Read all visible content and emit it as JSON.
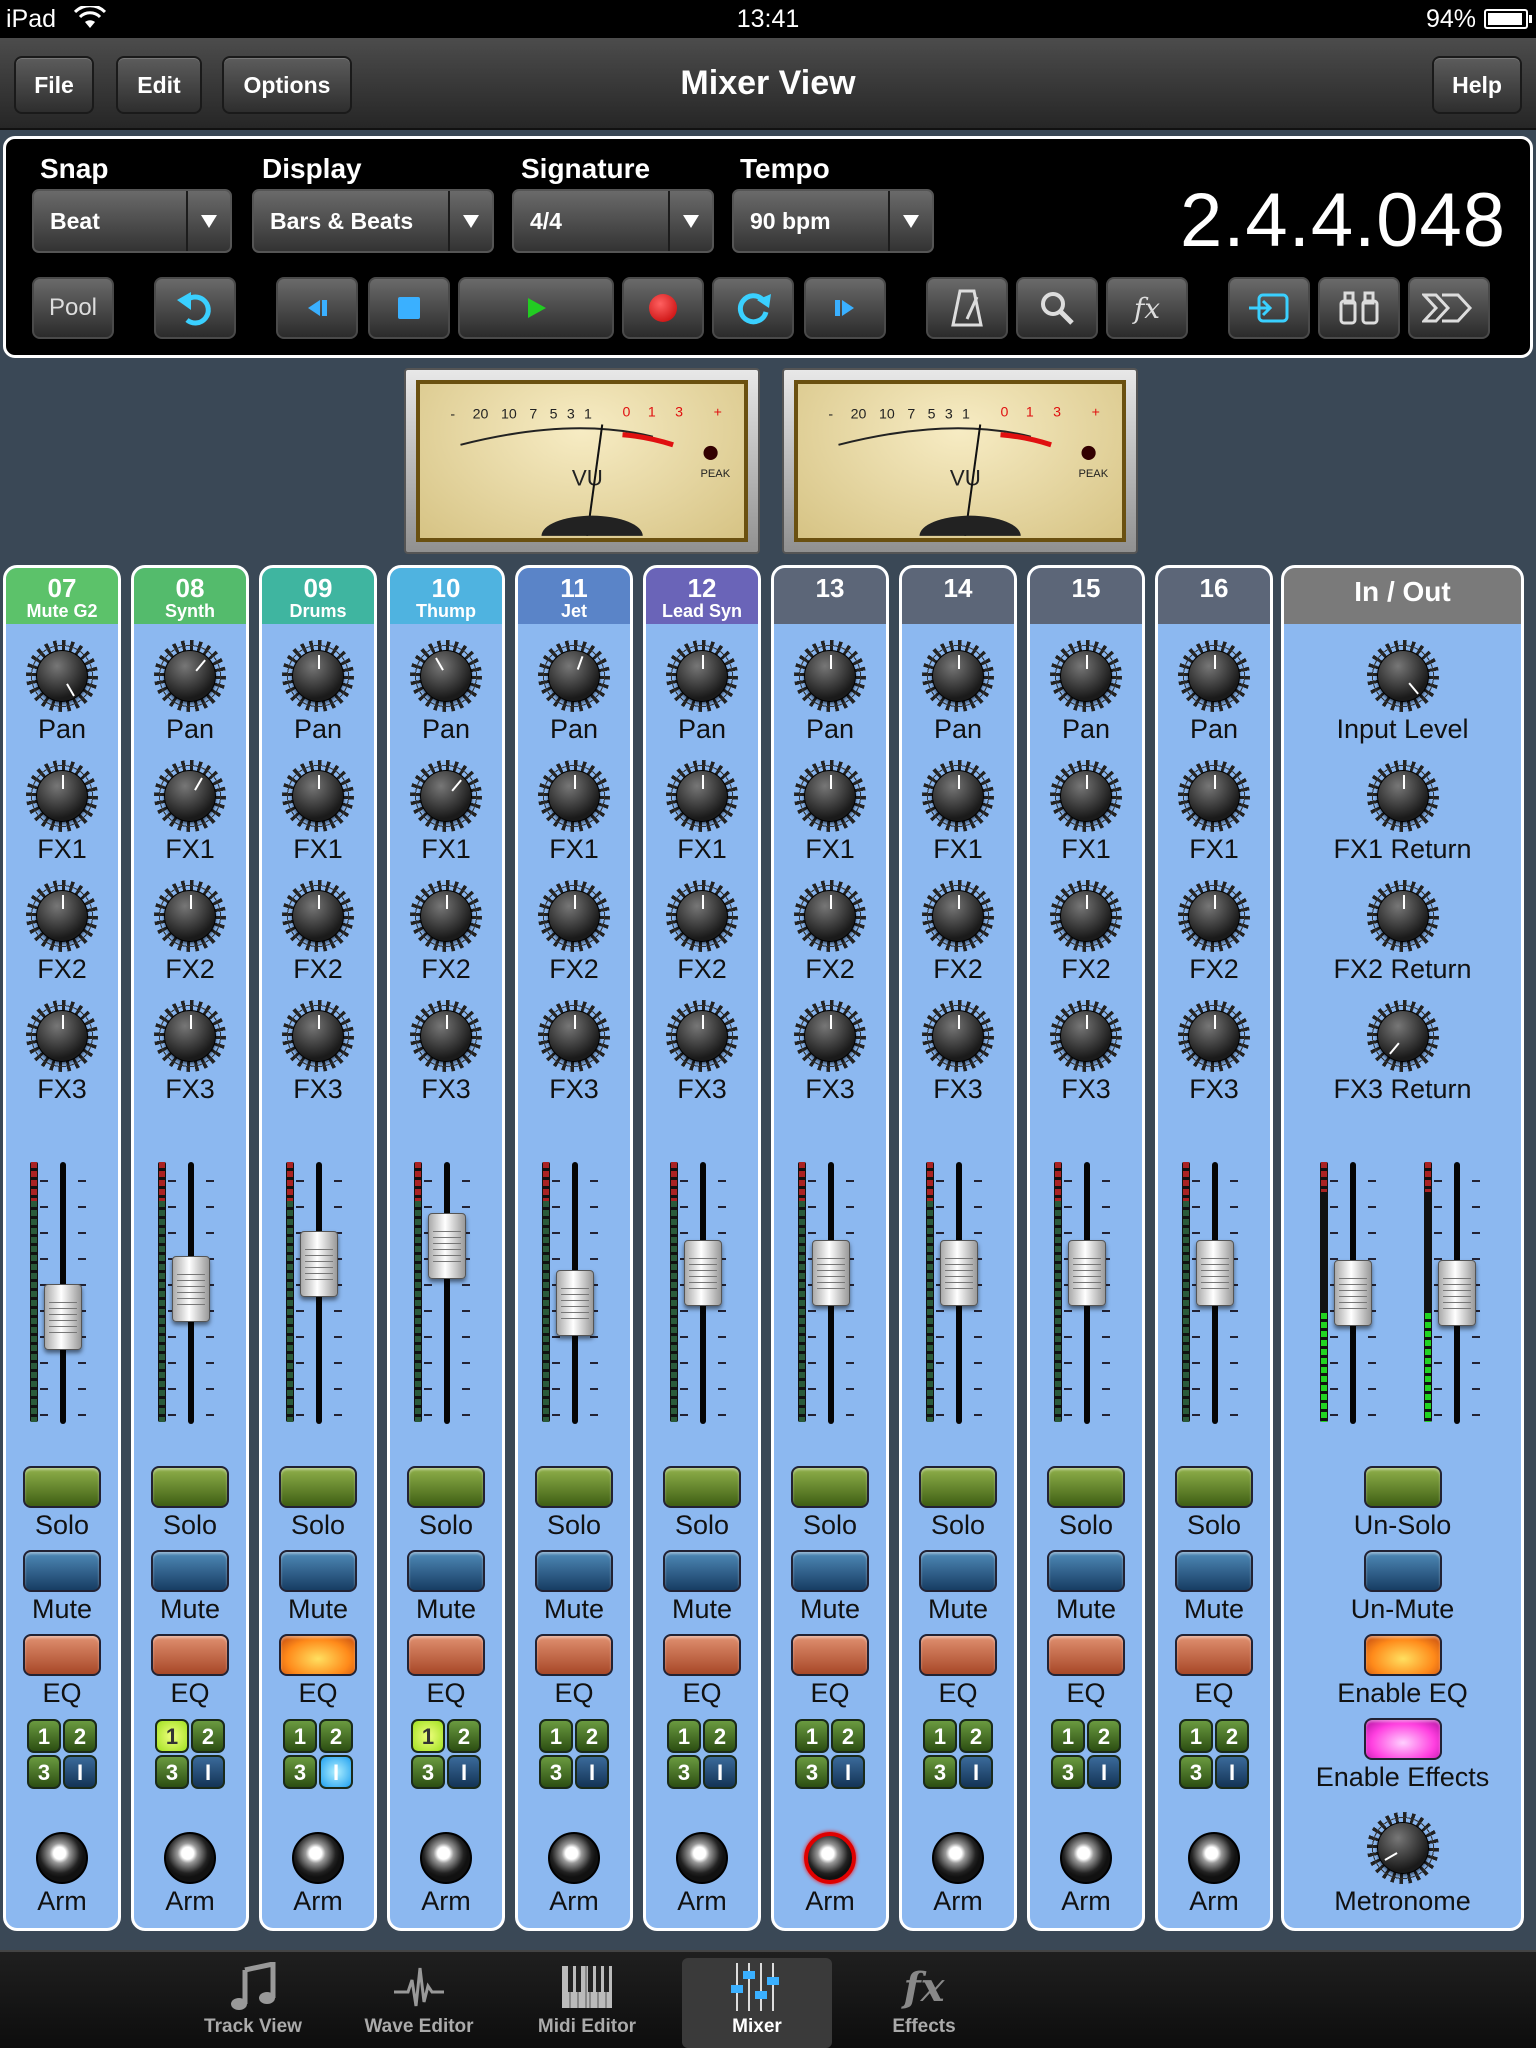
{
  "status": {
    "carrier": "iPad",
    "time": "13:41",
    "battery": "94%"
  },
  "nav": {
    "file": "File",
    "edit": "Edit",
    "options": "Options",
    "title": "Mixer View",
    "help": "Help"
  },
  "transport": {
    "snap_label": "Snap",
    "snap_value": "Beat",
    "display_label": "Display",
    "display_value": "Bars & Beats",
    "signature_label": "Signature",
    "signature_value": "4/4",
    "tempo_label": "Tempo",
    "tempo_value": "90 bpm",
    "position": "2.4.4.048",
    "pool": "Pool",
    "fx": "fx"
  },
  "vu": {
    "scale": [
      "-",
      "20",
      "10",
      "7",
      "5",
      "3",
      "1",
      "0",
      "1",
      "3",
      "+"
    ],
    "label": "VU",
    "peak": "PEAK"
  },
  "channels": [
    {
      "num": "07",
      "name": "Mute G2",
      "color": "#5cc26a",
      "fader": 0.38,
      "eq_on": false,
      "b1": false,
      "b4": false,
      "rec": false
    },
    {
      "num": "08",
      "name": "Synth",
      "color": "#54bb6c",
      "fader": 0.52,
      "eq_on": false,
      "b1": true,
      "b4": false,
      "rec": false
    },
    {
      "num": "09",
      "name": "Drums",
      "color": "#3fb5a0",
      "fader": 0.65,
      "eq_on": true,
      "b1": false,
      "b4": true,
      "rec": false
    },
    {
      "num": "10",
      "name": "Thump",
      "color": "#4fb3e0",
      "fader": 0.74,
      "eq_on": false,
      "b1": true,
      "b4": false,
      "rec": false
    },
    {
      "num": "11",
      "name": "Jet",
      "color": "#5a84c8",
      "fader": 0.45,
      "eq_on": false,
      "b1": false,
      "b4": false,
      "rec": false
    },
    {
      "num": "12",
      "name": "Lead Syn",
      "color": "#6a64b8",
      "fader": 0.6,
      "eq_on": false,
      "b1": false,
      "b4": false,
      "rec": false
    },
    {
      "num": "13",
      "name": "",
      "color": "#5c6678",
      "fader": 0.6,
      "eq_on": false,
      "b1": false,
      "b4": false,
      "rec": true
    },
    {
      "num": "14",
      "name": "",
      "color": "#5c6678",
      "fader": 0.6,
      "eq_on": false,
      "b1": false,
      "b4": false,
      "rec": false
    },
    {
      "num": "15",
      "name": "",
      "color": "#5c6678",
      "fader": 0.6,
      "eq_on": false,
      "b1": false,
      "b4": false,
      "rec": false
    },
    {
      "num": "16",
      "name": "",
      "color": "#5c6678",
      "fader": 0.6,
      "eq_on": false,
      "b1": false,
      "b4": false,
      "rec": false
    }
  ],
  "labels": {
    "pan": "Pan",
    "fx1": "FX1",
    "fx2": "FX2",
    "fx3": "FX3",
    "solo": "Solo",
    "mute": "Mute",
    "eq": "EQ",
    "arm": "Arm",
    "b1": "1",
    "b2": "2",
    "b3": "3",
    "b4": "I"
  },
  "io": {
    "title": "In / Out",
    "input": "Input Level",
    "fx1": "FX1 Return",
    "fx2": "FX2 Return",
    "fx3": "FX3 Return",
    "unsolo": "Un-Solo",
    "unmute": "Un-Mute",
    "enable_eq": "Enable EQ",
    "enable_fx": "Enable Effects",
    "metronome": "Metronome",
    "fader_l": 0.5,
    "fader_r": 0.5,
    "meter_l": 0.42,
    "meter_r": 0.42
  },
  "tabs": [
    {
      "label": "Track View",
      "icon": "music-note-icon",
      "active": false
    },
    {
      "label": "Wave Editor",
      "icon": "waveform-icon",
      "active": false
    },
    {
      "label": "Midi Editor",
      "icon": "piano-keys-icon",
      "active": false
    },
    {
      "label": "Mixer",
      "icon": "mixer-icon",
      "active": true
    },
    {
      "label": "Effects",
      "icon": "fx-icon",
      "active": false
    }
  ]
}
